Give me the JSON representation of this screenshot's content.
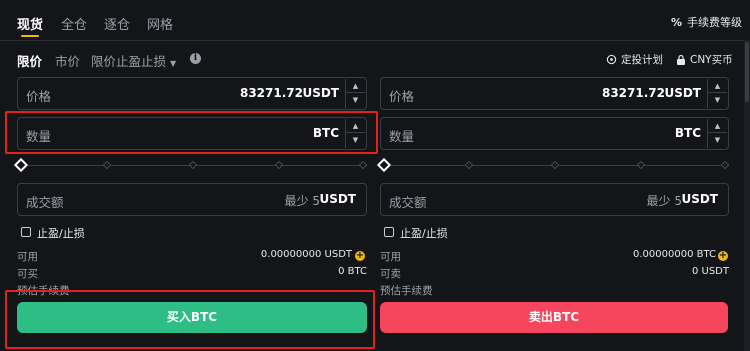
{
  "header": {
    "tabs": [
      {
        "label": "现货"
      },
      {
        "label": "全仓"
      },
      {
        "label": "逐仓"
      },
      {
        "label": "网格"
      }
    ],
    "fee_level": "手续费等级"
  },
  "order_types": {
    "limit": "限价",
    "market": "市价",
    "tpsl": "限价止盈止损"
  },
  "right_links": {
    "recurring": "定投计划",
    "cny": "CNY买币"
  },
  "buy": {
    "price_label": "价格",
    "price_value": "83271.72",
    "price_unit": "USDT",
    "qty_label": "数量",
    "qty_unit": "BTC",
    "total_label": "成交额",
    "total_hint": "最少 5",
    "total_unit": "USDT",
    "tpsl_label": "止盈/止损",
    "available_label": "可用",
    "available_value": "0.00000000 USDT",
    "can_buy_label": "可买",
    "can_buy_value": "0 BTC",
    "fee_label": "预估手续费",
    "button_label": "买入BTC"
  },
  "sell": {
    "price_label": "价格",
    "price_value": "83271.72",
    "price_unit": "USDT",
    "qty_label": "数量",
    "qty_unit": "BTC",
    "total_label": "成交额",
    "total_hint": "最少 5",
    "total_unit": "USDT",
    "tpsl_label": "止盈/止损",
    "available_label": "可用",
    "available_value": "0.00000000 BTC",
    "can_sell_label": "可卖",
    "can_sell_value": "0 USDT",
    "fee_label": "预估手续费",
    "button_label": "卖出BTC"
  },
  "colors": {
    "accent": "#f0b90b",
    "buy": "#2ebd85",
    "sell": "#f6465d",
    "highlight_box": "#e0231c"
  }
}
